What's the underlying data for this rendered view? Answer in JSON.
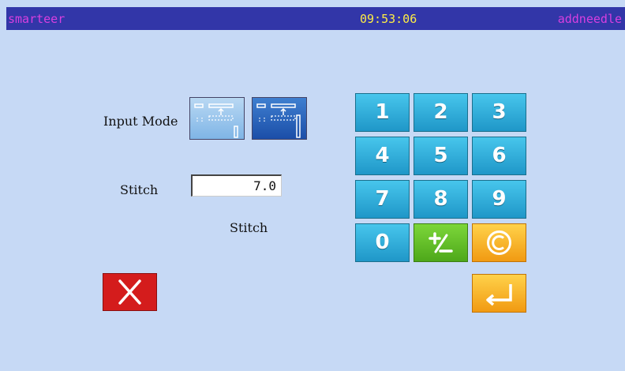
{
  "titlebar": {
    "left": "smarteer",
    "time": "09:53:06",
    "right": "addneedle"
  },
  "form": {
    "input_mode_label": "Input Mode",
    "stitch_label": "Stitch",
    "stitch_value": "7.0",
    "stitch_unit": "Stitch"
  },
  "keypad": {
    "k1": "1",
    "k2": "2",
    "k3": "3",
    "k4": "4",
    "k5": "5",
    "k6": "6",
    "k7": "7",
    "k8": "8",
    "k9": "9",
    "k0": "0"
  },
  "icons": {
    "mode_a": "stitch-mode-a-icon",
    "mode_b": "stitch-mode-b-icon",
    "sign": "plus-minus-icon",
    "clear": "copyright-clear-icon",
    "enter": "enter-return-icon",
    "cancel": "close-x-icon"
  },
  "colors": {
    "background": "#c6d9f5",
    "titlebar": "#3236a8",
    "title_text": "#d83fe0",
    "time_text": "#ffee44",
    "key_blue": "#2fb0e0",
    "key_green": "#5fbf27",
    "key_orange": "#f5b224",
    "cancel_red": "#d41c1c"
  }
}
